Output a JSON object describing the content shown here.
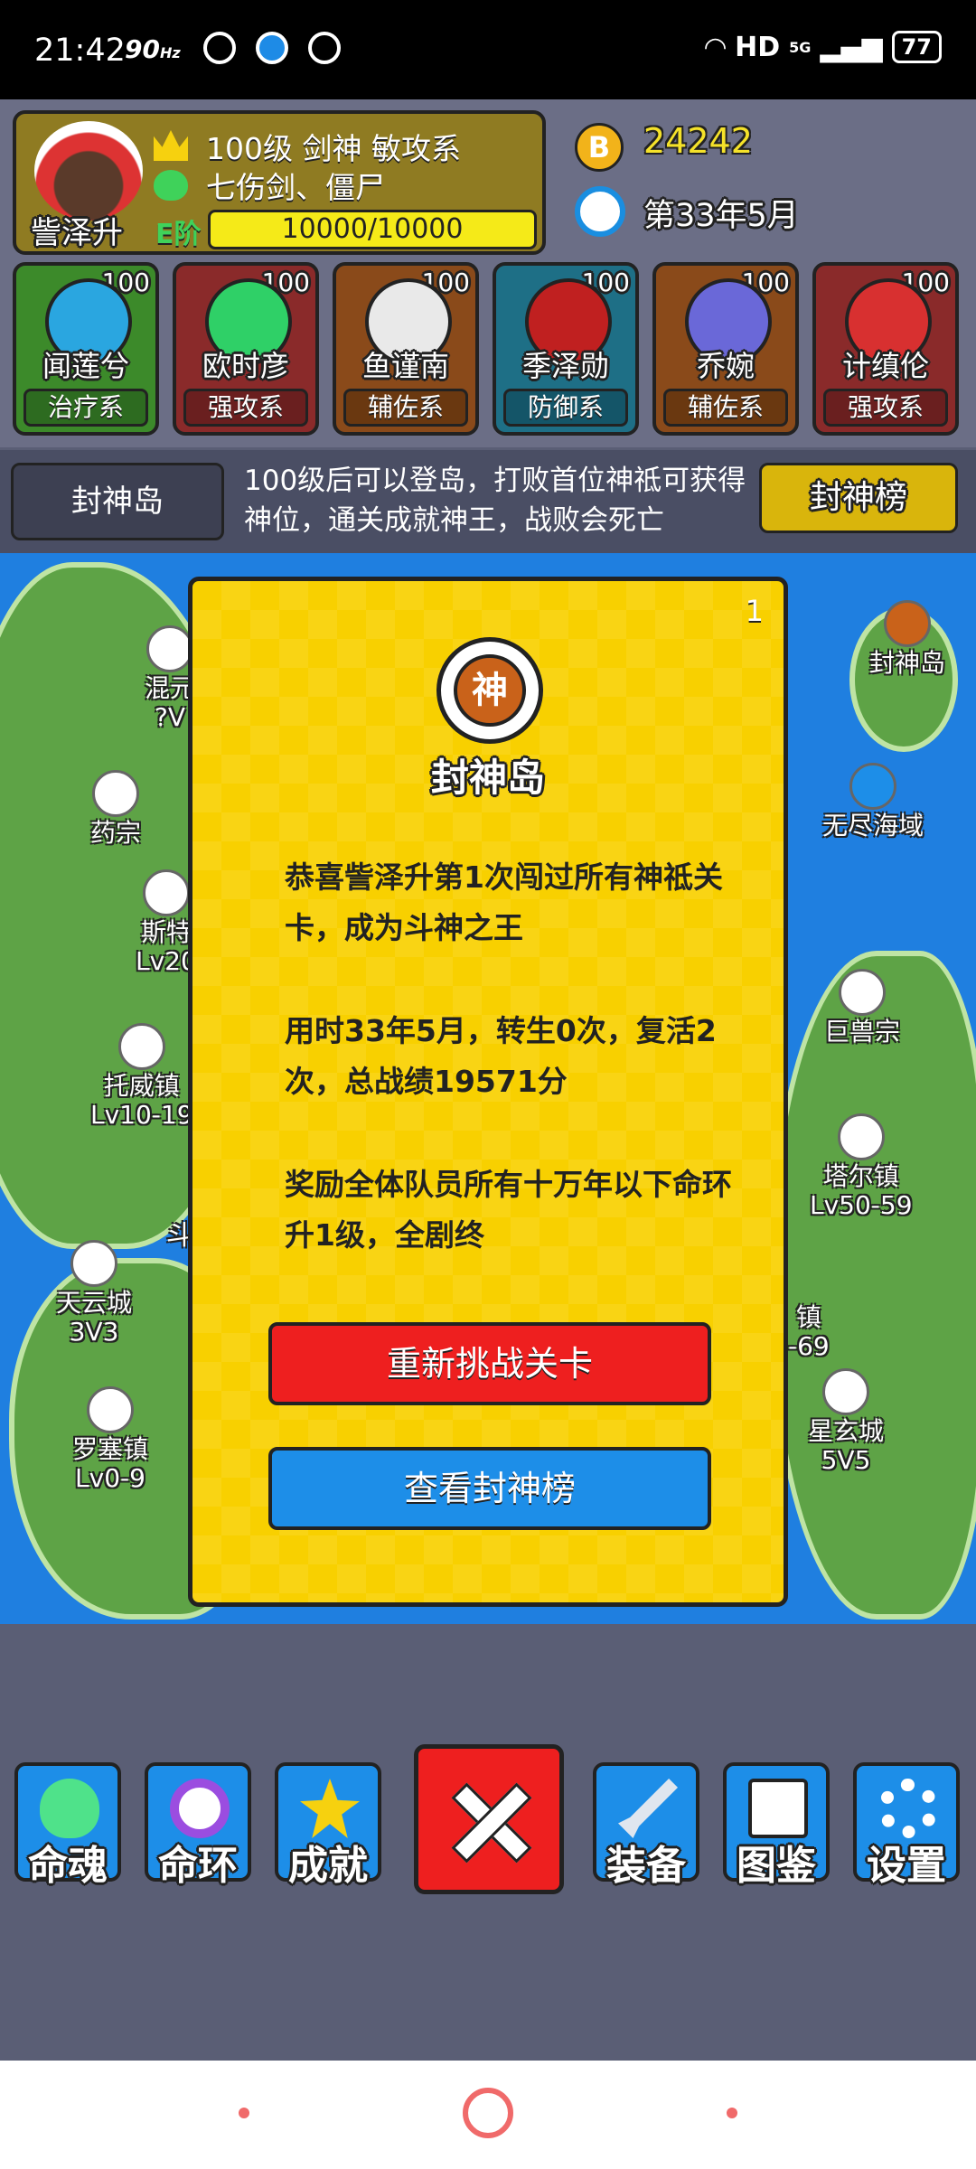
{
  "status": {
    "time": "21:42",
    "refresh": "90",
    "refresh_unit": "Hz",
    "network": "HD",
    "signal": "5G",
    "battery": "77"
  },
  "hero": {
    "name": "訾泽升",
    "line1": "100级 剑神 敏攻系",
    "line2": "七伤剑、僵尸",
    "level_tag": "E阶",
    "xp": "10000/10000",
    "xp_fraction": 1.0
  },
  "resources": {
    "coins": "24242",
    "coin_symbol": "B",
    "date": "第33年5月"
  },
  "team": [
    {
      "name": "闻莲兮",
      "level": "100",
      "class": "治疗系",
      "color": "#3c8a2a",
      "cls_color": "#2d6b20",
      "face": "#2aa6e0"
    },
    {
      "name": "欧时彦",
      "level": "100",
      "class": "强攻系",
      "color": "#8a2a2a",
      "cls_color": "#6a1f1f",
      "face": "#2fd067"
    },
    {
      "name": "鱼谨南",
      "level": "100",
      "class": "辅佐系",
      "color": "#8a4a1a",
      "cls_color": "#6a3810",
      "face": "#e9e9e9"
    },
    {
      "name": "季泽勋",
      "level": "100",
      "class": "防御系",
      "color": "#1e6f86",
      "cls_color": "#145568",
      "face": "#c02020"
    },
    {
      "name": "乔婉",
      "level": "100",
      "class": "辅佐系",
      "color": "#8a4a1a",
      "cls_color": "#6a3810",
      "face": "#6a68d8"
    },
    {
      "name": "计缜伦",
      "level": "100",
      "class": "强攻系",
      "color": "#8a2a2a",
      "cls_color": "#6a1f1f",
      "face": "#d83030"
    }
  ],
  "infobar": {
    "location": "封神岛",
    "description": "100级后可以登岛，打败首位神祗可获得神位，通关成就神王，战败会死亡",
    "rank_button": "封神榜"
  },
  "map": {
    "towns_left": [
      {
        "name": "混元",
        "sub": "?V"
      },
      {
        "name": "药宗",
        "sub": ""
      },
      {
        "name": "斯特",
        "sub": "Lv20"
      },
      {
        "name": "托威镇",
        "sub": "Lv10-19"
      },
      {
        "name": "天云城",
        "sub": "3V3"
      },
      {
        "name": "罗塞镇",
        "sub": "Lv0-9"
      }
    ],
    "towns_right": [
      {
        "name": "封神岛",
        "sub": ""
      },
      {
        "name": "无尽海域",
        "sub": ""
      },
      {
        "name": "巨兽宗",
        "sub": ""
      },
      {
        "name": "塔尔镇",
        "sub": "Lv50-59"
      },
      {
        "name": "镇",
        "sub": "-69"
      },
      {
        "name": "星玄城",
        "sub": "5V5"
      }
    ],
    "fragment": "斗"
  },
  "dialog": {
    "page": "1",
    "emblem_char": "神",
    "title": "封神岛",
    "para1": "恭喜訾泽升第1次闯过所有神祗关卡，成为斗神之王",
    "para2": "用时33年5月，转生0次，复活2次，总战绩19571分",
    "para3": "奖励全体队员所有十万年以下命环升1级，全剧终",
    "btn_retry": "重新挑战关卡",
    "btn_view": "查看封神榜"
  },
  "bottom_menu": {
    "soul": "命魂",
    "ring": "命环",
    "achieve": "成就",
    "equip": "装备",
    "guide": "图鉴",
    "settings": "设置"
  }
}
